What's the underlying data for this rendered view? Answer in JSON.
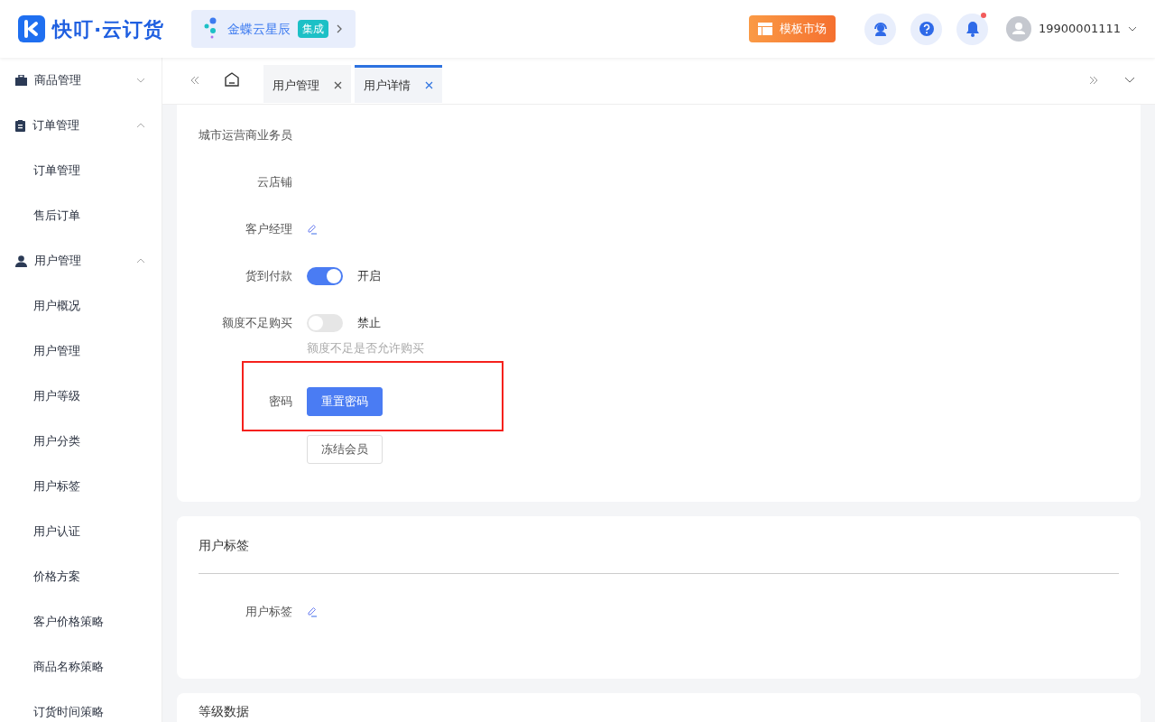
{
  "header": {
    "logo_text": "快叮·云订货",
    "integration": {
      "name": "金蝶云星辰",
      "badge": "集成"
    },
    "market_button": "模板市场",
    "notification_dot": true,
    "user": "19900001111"
  },
  "sidebar": [
    {
      "label": "商品管理",
      "expanded": false
    },
    {
      "label": "订单管理",
      "expanded": true,
      "children": [
        {
          "label": "订单管理"
        },
        {
          "label": "售后订单"
        }
      ]
    },
    {
      "label": "用户管理",
      "expanded": true,
      "children": [
        {
          "label": "用户概况"
        },
        {
          "label": "用户管理"
        },
        {
          "label": "用户等级"
        },
        {
          "label": "用户分类"
        },
        {
          "label": "用户标签"
        },
        {
          "label": "用户认证"
        },
        {
          "label": "价格方案"
        },
        {
          "label": "客户价格策略"
        },
        {
          "label": "商品名称策略"
        },
        {
          "label": "订货时间策略"
        }
      ]
    }
  ],
  "tabs": [
    {
      "label": "用户管理",
      "selected": false
    },
    {
      "label": "用户详情",
      "selected": true
    }
  ],
  "detail_fields": [
    {
      "label": "城市运营商业务员",
      "kind": "empty"
    },
    {
      "label": "云店铺",
      "kind": "empty"
    },
    {
      "label": "客户经理",
      "kind": "edit"
    },
    {
      "label": "货到付款",
      "kind": "switch",
      "on": true,
      "state_text": "开启"
    },
    {
      "label": "额度不足购买",
      "kind": "switch",
      "on": false,
      "state_text": "禁止",
      "hint": "额度不足是否允许购买"
    },
    {
      "label": "密码",
      "kind": "button",
      "button": "重置密码",
      "primary": true,
      "highlighted": true
    },
    {
      "kind": "button",
      "button": "冻结会员",
      "primary": false,
      "highlighted": false
    }
  ],
  "tag_section": {
    "title": "用户标签",
    "fields": [
      {
        "label": "用户标签",
        "kind": "edit"
      }
    ]
  },
  "next_section": {
    "title": "等级数据"
  }
}
